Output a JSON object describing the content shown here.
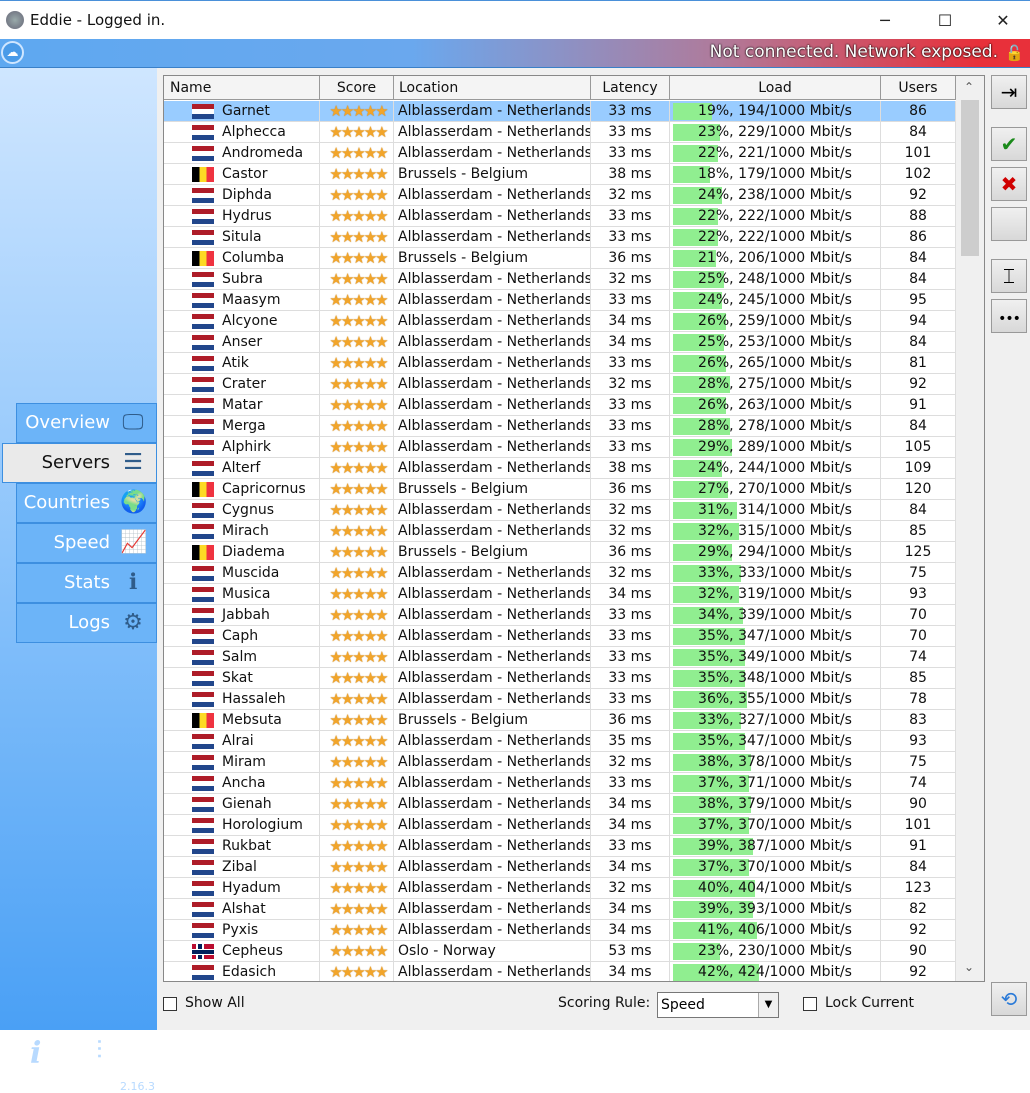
{
  "window": {
    "title": "Eddie - Logged in.",
    "minimize": "─",
    "maximize": "☐",
    "close": "✕"
  },
  "banner": {
    "status": "Not connected. Network exposed.",
    "status_color": "#e8303a"
  },
  "sidebar": {
    "items": [
      {
        "label": "Overview",
        "icon": "monitor-icon",
        "glyph": "🖵"
      },
      {
        "label": "Servers",
        "icon": "servers-icon",
        "glyph": "☰"
      },
      {
        "label": "Countries",
        "icon": "globe-icon",
        "glyph": "🌍"
      },
      {
        "label": "Speed",
        "icon": "chart-icon",
        "glyph": "📈"
      },
      {
        "label": "Stats",
        "icon": "info-icon",
        "glyph": "ℹ"
      },
      {
        "label": "Logs",
        "icon": "gears-icon",
        "glyph": "⚙"
      }
    ],
    "active": "Servers",
    "about_glyph": "i",
    "settings_glyph": "⫶",
    "version": "2.16.3"
  },
  "table": {
    "columns": [
      "Name",
      "Score",
      "Location",
      "Latency",
      "Load",
      "Users"
    ],
    "stars": "★★★★★",
    "rows": [
      [
        "Garnet",
        "nl",
        "Alblasserdam - Netherlands",
        "33 ms",
        19,
        "19%, 194/1000 Mbit/s",
        "86"
      ],
      [
        "Alphecca",
        "nl",
        "Alblasserdam - Netherlands",
        "33 ms",
        23,
        "23%, 229/1000 Mbit/s",
        "84"
      ],
      [
        "Andromeda",
        "nl",
        "Alblasserdam - Netherlands",
        "33 ms",
        22,
        "22%, 221/1000 Mbit/s",
        "101"
      ],
      [
        "Castor",
        "be",
        "Brussels - Belgium",
        "38 ms",
        18,
        "18%, 179/1000 Mbit/s",
        "102"
      ],
      [
        "Diphda",
        "nl",
        "Alblasserdam - Netherlands",
        "32 ms",
        24,
        "24%, 238/1000 Mbit/s",
        "92"
      ],
      [
        "Hydrus",
        "nl",
        "Alblasserdam - Netherlands",
        "33 ms",
        22,
        "22%, 222/1000 Mbit/s",
        "88"
      ],
      [
        "Situla",
        "nl",
        "Alblasserdam - Netherlands",
        "33 ms",
        22,
        "22%, 222/1000 Mbit/s",
        "86"
      ],
      [
        "Columba",
        "be",
        "Brussels - Belgium",
        "36 ms",
        21,
        "21%, 206/1000 Mbit/s",
        "84"
      ],
      [
        "Subra",
        "nl",
        "Alblasserdam - Netherlands",
        "32 ms",
        25,
        "25%, 248/1000 Mbit/s",
        "84"
      ],
      [
        "Maasym",
        "nl",
        "Alblasserdam - Netherlands",
        "33 ms",
        24,
        "24%, 245/1000 Mbit/s",
        "95"
      ],
      [
        "Alcyone",
        "nl",
        "Alblasserdam - Netherlands",
        "34 ms",
        26,
        "26%, 259/1000 Mbit/s",
        "94"
      ],
      [
        "Anser",
        "nl",
        "Alblasserdam - Netherlands",
        "34 ms",
        25,
        "25%, 253/1000 Mbit/s",
        "84"
      ],
      [
        "Atik",
        "nl",
        "Alblasserdam - Netherlands",
        "33 ms",
        26,
        "26%, 265/1000 Mbit/s",
        "81"
      ],
      [
        "Crater",
        "nl",
        "Alblasserdam - Netherlands",
        "32 ms",
        28,
        "28%, 275/1000 Mbit/s",
        "92"
      ],
      [
        "Matar",
        "nl",
        "Alblasserdam - Netherlands",
        "33 ms",
        26,
        "26%, 263/1000 Mbit/s",
        "91"
      ],
      [
        "Merga",
        "nl",
        "Alblasserdam - Netherlands",
        "33 ms",
        28,
        "28%, 278/1000 Mbit/s",
        "84"
      ],
      [
        "Alphirk",
        "nl",
        "Alblasserdam - Netherlands",
        "33 ms",
        29,
        "29%, 289/1000 Mbit/s",
        "105"
      ],
      [
        "Alterf",
        "nl",
        "Alblasserdam - Netherlands",
        "38 ms",
        24,
        "24%, 244/1000 Mbit/s",
        "109"
      ],
      [
        "Capricornus",
        "be",
        "Brussels - Belgium",
        "36 ms",
        27,
        "27%, 270/1000 Mbit/s",
        "120"
      ],
      [
        "Cygnus",
        "nl",
        "Alblasserdam - Netherlands",
        "32 ms",
        31,
        "31%, 314/1000 Mbit/s",
        "84"
      ],
      [
        "Mirach",
        "nl",
        "Alblasserdam - Netherlands",
        "32 ms",
        32,
        "32%, 315/1000 Mbit/s",
        "85"
      ],
      [
        "Diadema",
        "be",
        "Brussels - Belgium",
        "36 ms",
        29,
        "29%, 294/1000 Mbit/s",
        "125"
      ],
      [
        "Muscida",
        "nl",
        "Alblasserdam - Netherlands",
        "32 ms",
        33,
        "33%, 333/1000 Mbit/s",
        "75"
      ],
      [
        "Musica",
        "nl",
        "Alblasserdam - Netherlands",
        "34 ms",
        32,
        "32%, 319/1000 Mbit/s",
        "93"
      ],
      [
        "Jabbah",
        "nl",
        "Alblasserdam - Netherlands",
        "33 ms",
        34,
        "34%, 339/1000 Mbit/s",
        "70"
      ],
      [
        "Caph",
        "nl",
        "Alblasserdam - Netherlands",
        "33 ms",
        35,
        "35%, 347/1000 Mbit/s",
        "70"
      ],
      [
        "Salm",
        "nl",
        "Alblasserdam - Netherlands",
        "33 ms",
        35,
        "35%, 349/1000 Mbit/s",
        "74"
      ],
      [
        "Skat",
        "nl",
        "Alblasserdam - Netherlands",
        "33 ms",
        35,
        "35%, 348/1000 Mbit/s",
        "85"
      ],
      [
        "Hassaleh",
        "nl",
        "Alblasserdam - Netherlands",
        "33 ms",
        36,
        "36%, 355/1000 Mbit/s",
        "78"
      ],
      [
        "Mebsuta",
        "be",
        "Brussels - Belgium",
        "36 ms",
        33,
        "33%, 327/1000 Mbit/s",
        "83"
      ],
      [
        "Alrai",
        "nl",
        "Alblasserdam - Netherlands",
        "35 ms",
        35,
        "35%, 347/1000 Mbit/s",
        "93"
      ],
      [
        "Miram",
        "nl",
        "Alblasserdam - Netherlands",
        "32 ms",
        38,
        "38%, 378/1000 Mbit/s",
        "75"
      ],
      [
        "Ancha",
        "nl",
        "Alblasserdam - Netherlands",
        "33 ms",
        37,
        "37%, 371/1000 Mbit/s",
        "74"
      ],
      [
        "Gienah",
        "nl",
        "Alblasserdam - Netherlands",
        "34 ms",
        38,
        "38%, 379/1000 Mbit/s",
        "90"
      ],
      [
        "Horologium",
        "nl",
        "Alblasserdam - Netherlands",
        "34 ms",
        37,
        "37%, 370/1000 Mbit/s",
        "101"
      ],
      [
        "Rukbat",
        "nl",
        "Alblasserdam - Netherlands",
        "33 ms",
        39,
        "39%, 387/1000 Mbit/s",
        "91"
      ],
      [
        "Zibal",
        "nl",
        "Alblasserdam - Netherlands",
        "34 ms",
        37,
        "37%, 370/1000 Mbit/s",
        "84"
      ],
      [
        "Hyadum",
        "nl",
        "Alblasserdam - Netherlands",
        "32 ms",
        40,
        "40%, 404/1000 Mbit/s",
        "123"
      ],
      [
        "Alshat",
        "nl",
        "Alblasserdam - Netherlands",
        "34 ms",
        39,
        "39%, 393/1000 Mbit/s",
        "82"
      ],
      [
        "Pyxis",
        "nl",
        "Alblasserdam - Netherlands",
        "34 ms",
        41,
        "41%, 406/1000 Mbit/s",
        "92"
      ],
      [
        "Cepheus",
        "no",
        "Oslo - Norway",
        "53 ms",
        23,
        "23%, 230/1000 Mbit/s",
        "90"
      ],
      [
        "Edasich",
        "nl",
        "Alblasserdam - Netherlands",
        "34 ms",
        42,
        "42%, 424/1000 Mbit/s",
        "92"
      ]
    ],
    "selected_row": 0
  },
  "footer": {
    "show_all": "Show All",
    "scoring_label": "Scoring Rule:",
    "scoring_value": "Speed",
    "lock_current": "Lock Current"
  },
  "actions": [
    {
      "name": "connect-button",
      "icon": "enter-icon",
      "glyph": "⇥"
    },
    {
      "name": "whitelist-button",
      "icon": "check-icon",
      "glyph": "✔",
      "color": "#1a8a1a"
    },
    {
      "name": "blacklist-button",
      "icon": "x-icon",
      "glyph": "✖",
      "color": "#d00000"
    },
    {
      "name": "clear-button",
      "icon": "blank-icon",
      "glyph": ""
    },
    {
      "name": "rename-button",
      "icon": "rename-icon",
      "glyph": "⌶"
    },
    {
      "name": "more-button",
      "icon": "more-icon",
      "glyph": "•••"
    },
    {
      "name": "refresh-button",
      "icon": "refresh-icon",
      "glyph": "⟲",
      "color": "#2a7ad8"
    }
  ]
}
